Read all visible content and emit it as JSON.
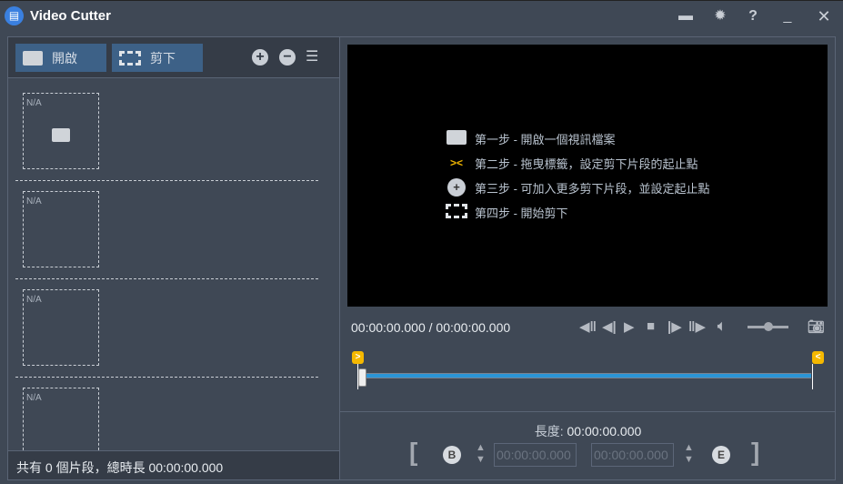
{
  "window": {
    "title": "Video Cutter",
    "icon": "film-icon",
    "controls": [
      "folder-icon",
      "gear-icon",
      "help-icon",
      "minimize-icon",
      "close-icon"
    ],
    "help_label": "?"
  },
  "toolbar": {
    "open_label": "開啟",
    "cut_label": "剪下"
  },
  "segments": [
    {
      "label": "N/A"
    },
    {
      "label": "N/A"
    },
    {
      "label": "N/A"
    },
    {
      "label": "N/A"
    }
  ],
  "footer": {
    "prefix": "共有",
    "count": "0",
    "middle": "個片段，總時長",
    "total": "00:00:00.000"
  },
  "steps": [
    {
      "icon": "folder-icon",
      "text": "第一步 - 開啟一個視訊檔案"
    },
    {
      "icon": "flags-icon",
      "text": "第二步 - 拖曳標籤，設定剪下片段的起止點"
    },
    {
      "icon": "plus-circle-icon",
      "text": "第三步 - 可加入更多剪下片段，並設定起止點"
    },
    {
      "icon": "film-icon",
      "text": "第四步 - 開始剪下"
    }
  ],
  "player": {
    "timecode": "00:00:00.000 / 00:00:00.000",
    "volume": 0.5,
    "position": 0
  },
  "range": {
    "length_label": "長度:",
    "length_value": "00:00:00.000",
    "start": "00:00:00.000",
    "end": "00:00:00.000",
    "start_flag": ">",
    "end_flag": "<",
    "begin_badge": "B",
    "end_badge": "E"
  },
  "colors": {
    "accent": "#2b95d6",
    "flag": "#f5b800",
    "button": "#3d6187"
  }
}
